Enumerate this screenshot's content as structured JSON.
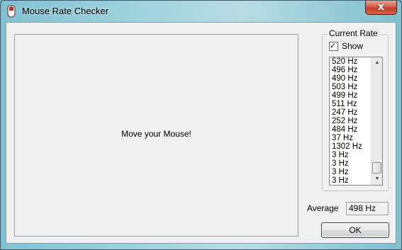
{
  "window": {
    "title": "Mouse Rate Checker",
    "close_glyph": "x",
    "app_icon": "mouse-app-icon"
  },
  "main": {
    "prompt": "Move your Mouse!"
  },
  "rate_group": {
    "title": "Current Rate",
    "show_label": "Show",
    "show_checked": true,
    "check_glyph": "✓",
    "rates": [
      "520 Hz",
      "496 Hz",
      "490 Hz",
      "503 Hz",
      "499 Hz",
      "511 Hz",
      "247 Hz",
      "252 Hz",
      "484 Hz",
      "37 Hz",
      "1302 Hz",
      "3 Hz",
      "3 Hz",
      "3 Hz",
      "3 Hz"
    ],
    "scroll_up_glyph": "▲",
    "scroll_down_glyph": "▼"
  },
  "average": {
    "label": "Average",
    "value": "498 Hz"
  },
  "ok_button": {
    "label": "OK"
  },
  "colors": {
    "close_red": "#c33d24",
    "client_bg": "#f0f0f0"
  }
}
